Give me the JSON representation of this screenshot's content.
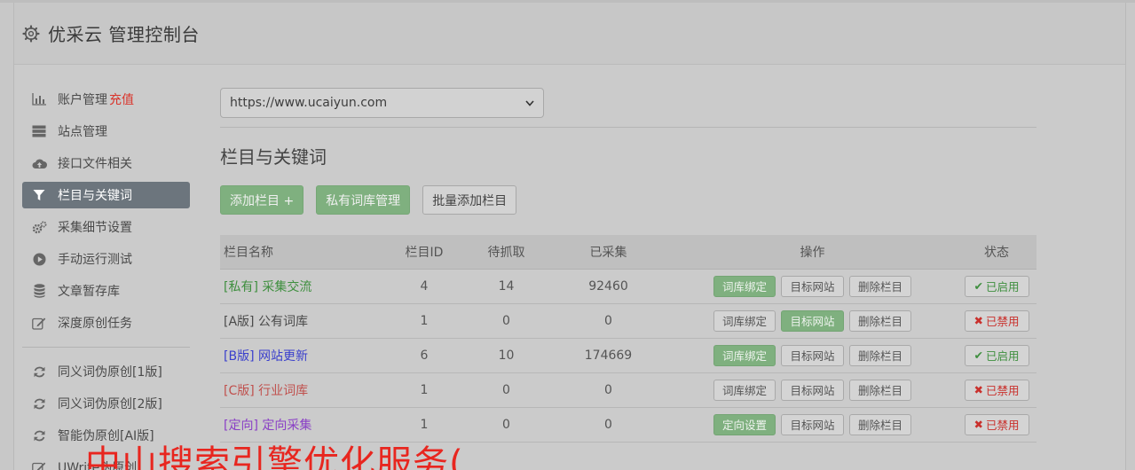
{
  "header": {
    "title": "优采云 管理控制台"
  },
  "sidebar": {
    "items": [
      {
        "label": "账户管理",
        "extra": "充值",
        "icon": "bar-chart-icon"
      },
      {
        "label": "站点管理",
        "icon": "server-icon"
      },
      {
        "label": "接口文件相关",
        "icon": "cloud-upload-icon"
      },
      {
        "label": "栏目与关键词",
        "icon": "filter-icon",
        "active": true
      },
      {
        "label": "采集细节设置",
        "icon": "cogs-icon"
      },
      {
        "label": "手动运行测试",
        "icon": "play-circle-icon"
      },
      {
        "label": "文章暂存库",
        "icon": "database-icon"
      },
      {
        "label": "深度原创任务",
        "icon": "edit-icon"
      }
    ],
    "items2": [
      {
        "label": "同义词伪原创[1版]",
        "icon": "refresh-icon"
      },
      {
        "label": "同义词伪原创[2版]",
        "icon": "refresh-icon"
      },
      {
        "label": "智能伪原创[AI版]",
        "icon": "refresh-icon"
      },
      {
        "label": "UWrite伪原创",
        "icon": "edit-icon"
      }
    ]
  },
  "main": {
    "site_select": {
      "value": "https://www.ucaiyun.com"
    },
    "section_title": "栏目与关键词",
    "buttons": {
      "add_column": "添加栏目 +",
      "private_lib": "私有词库管理",
      "batch_add": "批量添加栏目"
    },
    "table": {
      "headers": [
        "栏目名称",
        "栏目ID",
        "待抓取",
        "已采集",
        "操作",
        "状态"
      ],
      "rows": [
        {
          "tag": "[私有]",
          "name": "采集交流",
          "id": "4",
          "wait": "14",
          "done": "92460",
          "op1": "词库绑定",
          "op2": "目标网站",
          "op3": "删除栏目",
          "status": "已启用",
          "status_icon": "✔"
        },
        {
          "tag": "[A版]",
          "name": "公有词库",
          "id": "1",
          "wait": "0",
          "done": "0",
          "op1": "词库绑定",
          "op2": "目标网站",
          "op3": "删除栏目",
          "status": "已禁用",
          "status_icon": "✖"
        },
        {
          "tag": "[B版]",
          "name": "网站更新",
          "id": "6",
          "wait": "10",
          "done": "174669",
          "op1": "词库绑定",
          "op2": "目标网站",
          "op3": "删除栏目",
          "status": "已启用",
          "status_icon": "✔"
        },
        {
          "tag": "[C版]",
          "name": "行业词库",
          "id": "1",
          "wait": "0",
          "done": "0",
          "op1": "词库绑定",
          "op2": "目标网站",
          "op3": "删除栏目",
          "status": "已禁用",
          "status_icon": "✖"
        },
        {
          "tag": "[定向]",
          "name": "定向采集",
          "id": "1",
          "wait": "0",
          "done": "0",
          "op1": "定向设置",
          "op2": "目标网站",
          "op3": "删除栏目",
          "status": "已禁用",
          "status_icon": "✖"
        }
      ]
    }
  },
  "overlay": {
    "text": "中山搜索引擎优化服务("
  },
  "colors": {
    "private": "#3f8f3f",
    "a_version": "#4a4a4a",
    "b_version": "#3a3fcc",
    "c_version": "#c0504d",
    "directed": "#8a3fc6"
  }
}
